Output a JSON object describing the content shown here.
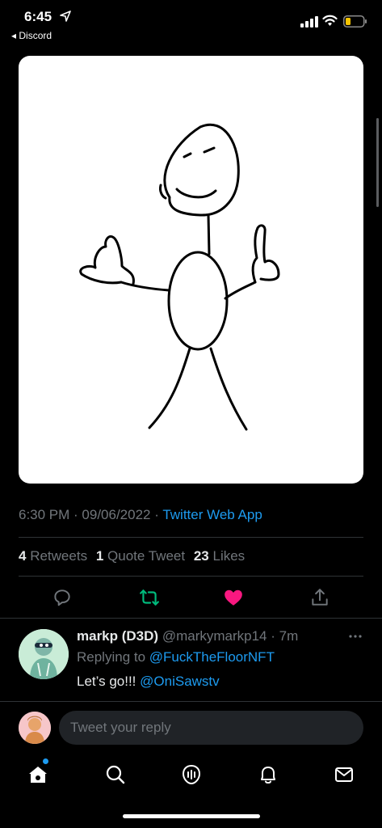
{
  "status_bar": {
    "time": "6:45",
    "back_app": "◂ Discord"
  },
  "tweet": {
    "media_description_icon": "stick-figure-drawing",
    "time": "6:30 PM",
    "sep1": " · ",
    "date": "09/06/2022",
    "sep2": " · ",
    "source": "Twitter Web App",
    "retweets_count": "4",
    "retweets_label": "Retweets",
    "quotes_count": "1",
    "quotes_label": "Quote Tweet",
    "likes_count": "23",
    "likes_label": "Likes"
  },
  "actions": {
    "reply_icon": "reply-icon",
    "retweet_icon": "retweet-icon",
    "like_icon": "heart-icon",
    "share_icon": "share-icon",
    "retweet_color": "#00ba7c",
    "like_color": "#f91880"
  },
  "reply": {
    "name": "markp (D3D)",
    "handle": "@markymarkp14",
    "time": " · 7m",
    "replying_prefix": "Replying to ",
    "replying_to": "@FuckTheFloorNFT",
    "text": "Let’s go!!! ",
    "text_mention": "@OniSawstv"
  },
  "compose": {
    "placeholder": "Tweet your reply"
  },
  "nav": {
    "items": [
      "home-icon",
      "search-icon",
      "spaces-icon",
      "notifications-icon",
      "messages-icon"
    ]
  },
  "colors": {
    "accent": "#1d9bf0",
    "background": "#000000",
    "muted": "#71767b"
  }
}
